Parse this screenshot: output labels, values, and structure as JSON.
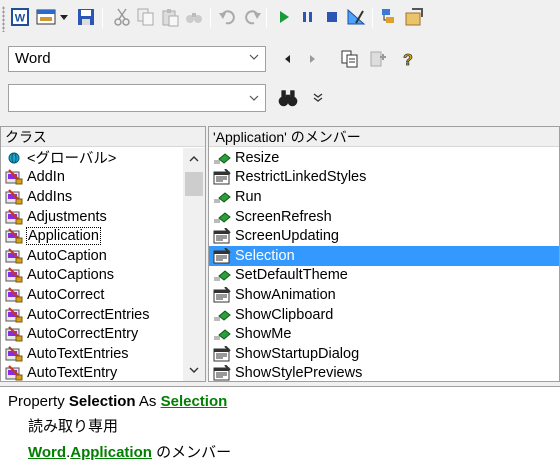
{
  "toolbar": {
    "buttons": [
      {
        "name": "word-icon"
      },
      {
        "name": "view-object-icon"
      },
      {
        "name": "dropdown-arrow-icon"
      },
      {
        "name": "save-icon"
      },
      {
        "name": "cut-icon"
      },
      {
        "name": "copy-icon"
      },
      {
        "name": "paste-icon"
      },
      {
        "name": "find-icon"
      },
      {
        "name": "undo-icon"
      },
      {
        "name": "redo-icon"
      },
      {
        "name": "run-icon"
      },
      {
        "name": "break-icon"
      },
      {
        "name": "reset-icon"
      },
      {
        "name": "design-mode-icon"
      },
      {
        "name": "project-explorer-icon"
      },
      {
        "name": "properties-icon"
      }
    ]
  },
  "library": {
    "value": "Word"
  },
  "search": {
    "value": ""
  },
  "classes": {
    "header": "クラス",
    "items": [
      {
        "label": "<グローバル>",
        "icon": "globe"
      },
      {
        "label": "AddIn",
        "icon": "class"
      },
      {
        "label": "AddIns",
        "icon": "class"
      },
      {
        "label": "Adjustments",
        "icon": "class"
      },
      {
        "label": "Application",
        "icon": "class",
        "focused": true
      },
      {
        "label": "AutoCaption",
        "icon": "class"
      },
      {
        "label": "AutoCaptions",
        "icon": "class"
      },
      {
        "label": "AutoCorrect",
        "icon": "class"
      },
      {
        "label": "AutoCorrectEntries",
        "icon": "class"
      },
      {
        "label": "AutoCorrectEntry",
        "icon": "class"
      },
      {
        "label": "AutoTextEntries",
        "icon": "class"
      },
      {
        "label": "AutoTextEntry",
        "icon": "class"
      }
    ]
  },
  "members": {
    "header": "'Application' のメンバー",
    "items": [
      {
        "label": "Resize",
        "icon": "method"
      },
      {
        "label": "RestrictLinkedStyles",
        "icon": "property"
      },
      {
        "label": "Run",
        "icon": "method"
      },
      {
        "label": "ScreenRefresh",
        "icon": "method"
      },
      {
        "label": "ScreenUpdating",
        "icon": "property"
      },
      {
        "label": "Selection",
        "icon": "property",
        "selected": true
      },
      {
        "label": "SetDefaultTheme",
        "icon": "method"
      },
      {
        "label": "ShowAnimation",
        "icon": "property"
      },
      {
        "label": "ShowClipboard",
        "icon": "method"
      },
      {
        "label": "ShowMe",
        "icon": "method"
      },
      {
        "label": "ShowStartupDialog",
        "icon": "property"
      },
      {
        "label": "ShowStylePreviews",
        "icon": "property"
      }
    ]
  },
  "details": {
    "kind": "Property",
    "member": "Selection",
    "as_word": "As",
    "type_link": "Selection",
    "access": "読み取り専用",
    "library_link": "Word",
    "dot": ".",
    "class_link": "Application",
    "member_of": "のメンバー"
  },
  "colors": {
    "selection": "#3399ff",
    "link": "#008000"
  }
}
